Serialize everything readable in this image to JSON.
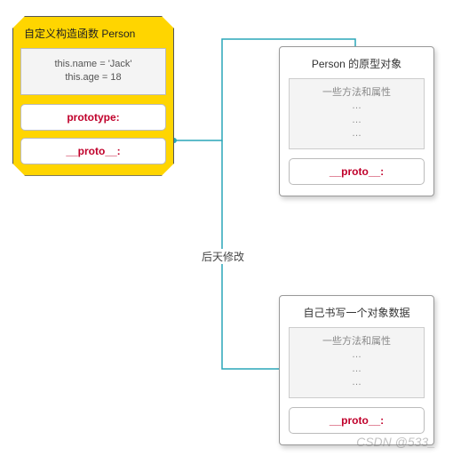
{
  "constructor_box": {
    "title": "自定义构造函数 Person",
    "code_line1": "this.name = 'Jack'",
    "code_line2": "this.age = 18",
    "prototype_label": "prototype:",
    "proto_label": "__proto__:"
  },
  "prototype_obj": {
    "title": "Person  的原型对象",
    "body_title": "一些方法和属性",
    "ellipsis": "…",
    "proto_label": "__proto__:"
  },
  "custom_obj": {
    "title": "自己书写一个对象数据",
    "body_title": "一些方法和属性",
    "ellipsis": "…",
    "proto_label": "__proto__:"
  },
  "note": "后天修改",
  "watermark": "CSDN @533_"
}
